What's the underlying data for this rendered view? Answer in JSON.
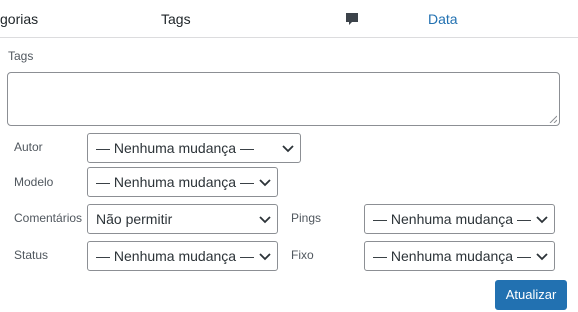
{
  "header": {
    "categories_label": "gorias",
    "tags_label": "Tags",
    "comment_icon": "comment-icon",
    "date_label": "Data"
  },
  "tags": {
    "label": "Tags",
    "value": ""
  },
  "fields": {
    "author": {
      "label": "Autor",
      "value": "— Nenhuma mudança —"
    },
    "template": {
      "label": "Modelo",
      "value": "— Nenhuma mudança —"
    },
    "comments": {
      "label": "Comentários",
      "value": "Não permitir"
    },
    "pings": {
      "label": "Pings",
      "value": "— Nenhuma mudança —"
    },
    "status": {
      "label": "Status",
      "value": "— Nenhuma mudança —"
    },
    "sticky": {
      "label": "Fixo",
      "value": "— Nenhuma mudança —"
    }
  },
  "actions": {
    "update_label": "Atualizar"
  },
  "colors": {
    "link": "#2271b1",
    "button": "#2271b1",
    "comment_icon": "#3c434a"
  }
}
